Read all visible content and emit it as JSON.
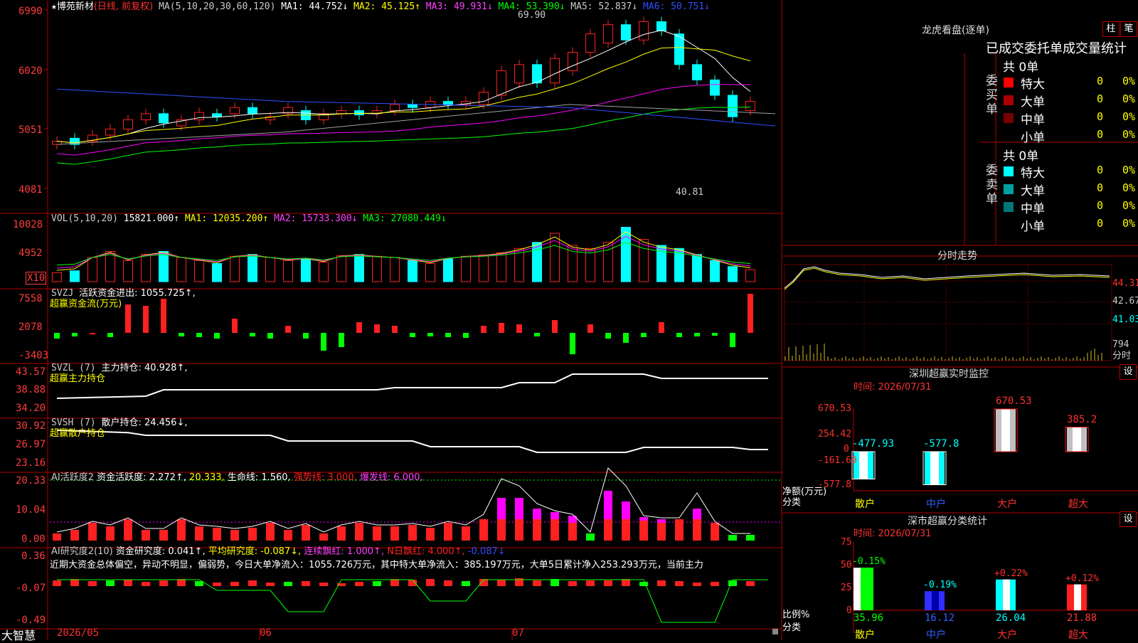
{
  "colors": {
    "up": "#ff2020",
    "down": "#00ffff",
    "frame": "#b00000",
    "ma1": "#ffffff",
    "ma2": "#ffff00",
    "ma3": "#ff00ff",
    "ma4": "#00ff00",
    "ma5": "#a0a0a0",
    "ma6": "#3050ff"
  },
  "kline": {
    "header": {
      "star": "★",
      "name": "博苑新材",
      "period": "(日线, 前复权)",
      "ma_label": "MA(5,10,20,30,60,120)",
      "ma1": "MA1: 44.752↓",
      "ma2": "MA2: 45.125↑",
      "ma3": "MA3: 49.931↓",
      "ma4": "MA4: 53.390↓",
      "ma5": "MA5: 52.837↓",
      "ma6": "MA6: 50.751↓"
    },
    "axis": [
      "6990",
      "6020",
      "5051",
      "4081"
    ],
    "high_label": "69.90",
    "low_label": "40.81"
  },
  "vol": {
    "header": {
      "label": "VOL(5,10,20)",
      "v": "15821.000↑",
      "ma1": "MA1: 12035.200↑",
      "ma2": "MA2: 15733.300↓",
      "ma3": "MA3: 27080.449↓"
    },
    "axis": [
      "10028",
      "4952"
    ],
    "unit": "X10"
  },
  "svzj": {
    "header": {
      "label": "SVZJ",
      "title": "活跃资金进出: 1055.725↑,",
      "sub": "超赢资金流(万元)"
    },
    "axis": [
      "7558",
      "2078",
      "-3403"
    ]
  },
  "svzl": {
    "header": {
      "label": "SVZL (7)",
      "title": "主力持仓: 40.928↑,",
      "sub": "超赢主力持仓"
    },
    "axis": [
      "43.57",
      "38.88",
      "34.20"
    ]
  },
  "svsh": {
    "header": {
      "label": "SVSH (7)",
      "title": "散户持仓: 24.456↓,",
      "sub": "超赢散户持仓"
    },
    "axis": [
      "30.92",
      "26.97",
      "23.16"
    ]
  },
  "aihy": {
    "header": {
      "label": "AI活跃度2",
      "a": "资金活跃度: 2.272↑,",
      "b": "20.333,",
      "c": "生命线: 1.560,",
      "d": "强势线: 3.000,",
      "e": "爆发线: 6.000,"
    },
    "axis": [
      "20.33",
      "10.04",
      "0.00"
    ]
  },
  "aiyj": {
    "header": {
      "label": "AI研究度2(10)",
      "a": "资金研究度: 0.041↑,",
      "b": "平均研究度: -0.087↓,",
      "c": "连续飘红: 1.000↑,",
      "d": "N日飘红: 4.000↑,",
      "e": "-0.087↓"
    },
    "summary": "近期大资金总体偏空，异动不明显，偏弱势，今日大单净流入：1055.726万元，其中特大单净流入：385.197万元，大单5日累计净入253.293万元，当前主力",
    "axis": [
      "0.36",
      "-0.07",
      "-0.49"
    ]
  },
  "xaxis": {
    "brand": "大智慧",
    "labels": [
      "2026/05",
      "06",
      "07"
    ]
  },
  "lhb": {
    "title": "龙虎看盘(逐单)",
    "btn1": "柱",
    "btn2": "笔",
    "tabs": "已成交委托单成交量统计",
    "buy": {
      "side": "委买单",
      "total": "共 0单",
      "rows": [
        {
          "n": "特大",
          "v": "0",
          "p": "0%",
          "c": "#ff0000"
        },
        {
          "n": "大单",
          "v": "0",
          "p": "0%",
          "c": "#aa0000"
        },
        {
          "n": "中单",
          "v": "0",
          "p": "0%",
          "c": "#770000"
        },
        {
          "n": "小单",
          "v": "0",
          "p": "0%",
          "c": "#000000"
        }
      ]
    },
    "sell": {
      "side": "委卖单",
      "total": "共 0单",
      "rows": [
        {
          "n": "特大",
          "v": "0",
          "p": "0%",
          "c": "#00ffff"
        },
        {
          "n": "大单",
          "v": "0",
          "p": "0%",
          "c": "#00a0a0"
        },
        {
          "n": "中单",
          "v": "0",
          "p": "0%",
          "c": "#007777"
        },
        {
          "n": "小单",
          "v": "0",
          "p": "0%",
          "c": "#000000"
        }
      ]
    }
  },
  "intraday": {
    "title": "分时走势",
    "axis": [
      "44.31",
      "42.67",
      "41.03",
      "794",
      "分时"
    ]
  },
  "szmon": {
    "title": "深圳超赢实时监控",
    "btn": "设",
    "time": "时间: 2026/07/31",
    "axis": [
      "670.53",
      "254.42",
      "0",
      "-161.69",
      "-577.8"
    ],
    "ylabel1": "净额(万元)",
    "ylabel2": "分类"
  },
  "szclass": {
    "title": "深市超赢分类统计",
    "btn": "设",
    "time": "时间: 2026/07/31",
    "axis": [
      "75",
      "50",
      "25",
      "0"
    ],
    "ylabel1": "比例%",
    "ylabel2": "分类"
  },
  "chart_data": [
    {
      "type": "bar",
      "title": "深圳超赢实时监控",
      "categories": [
        "散户",
        "中户",
        "大户",
        "超大"
      ],
      "values": [
        -477.93,
        -577.8,
        670.53,
        385.2
      ],
      "ylabel": "净额(万元)",
      "ylim": [
        -577.8,
        670.53
      ]
    },
    {
      "type": "bar",
      "title": "深市超赢分类统计",
      "categories": [
        "散户",
        "中户",
        "大户",
        "超大"
      ],
      "values": [
        35.96,
        16.12,
        26.04,
        21.88
      ],
      "changes": [
        "-0.15%",
        "-0.19%",
        "+0.22%",
        "+0.12%"
      ],
      "ylabel": "比例%",
      "ylim": [
        0,
        75
      ]
    }
  ]
}
